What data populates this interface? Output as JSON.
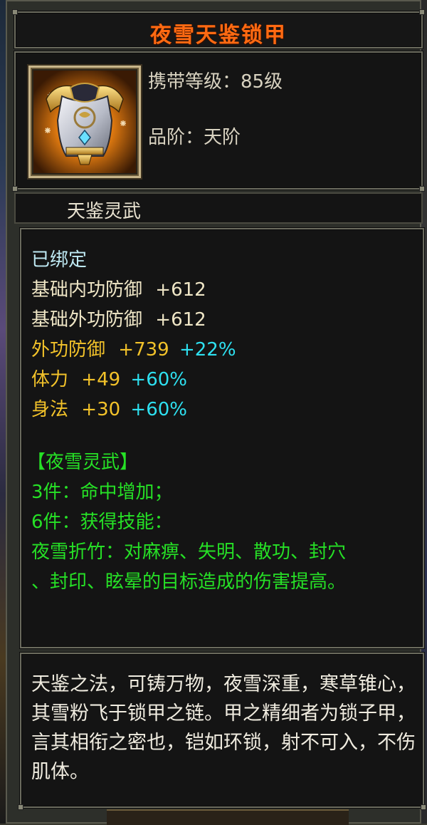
{
  "item": {
    "title": "夜雪天鉴锁甲",
    "carry_level": "携带等级：85级",
    "grade": "品阶：天阶",
    "set_name": "天鉴灵武"
  },
  "stats": {
    "bound": "已绑定",
    "base_inner_def": {
      "label": "基础内功防御",
      "value": "+612"
    },
    "base_outer_def": {
      "label": "基础外功防御",
      "value": "+612"
    },
    "outer_def": {
      "label": "外功防御",
      "value": "+739",
      "pct": "+22%"
    },
    "stamina": {
      "label": "体力",
      "value": "+49",
      "pct": "+60%"
    },
    "agility": {
      "label": "身法",
      "value": "+30",
      "pct": "+60%"
    }
  },
  "set_bonus": {
    "header": "【夜雪灵武】",
    "piece3": "3件：命中增加；",
    "piece6": "6件：获得技能：",
    "skill_line1": "夜雪折竹：对麻痹、失明、散功、封穴",
    "skill_line2": "、封印、眩晕的目标造成的伤害提高。"
  },
  "description": "天鉴之法，可铸万物，夜雪深重，寒草锥心，其雪粉飞于锁甲之链。甲之精细者为锁子甲，言其相衔之密也，铠如环锁，射不可入，不伤肌体。",
  "icon": "armor-chestplate-icon",
  "colors": {
    "title": "#ff6a12",
    "bound": "#bfeaf4",
    "base_stat": "#efe6c6",
    "stat": "#f2c22a",
    "percent": "#2ee0f0",
    "set": "#26e026"
  }
}
